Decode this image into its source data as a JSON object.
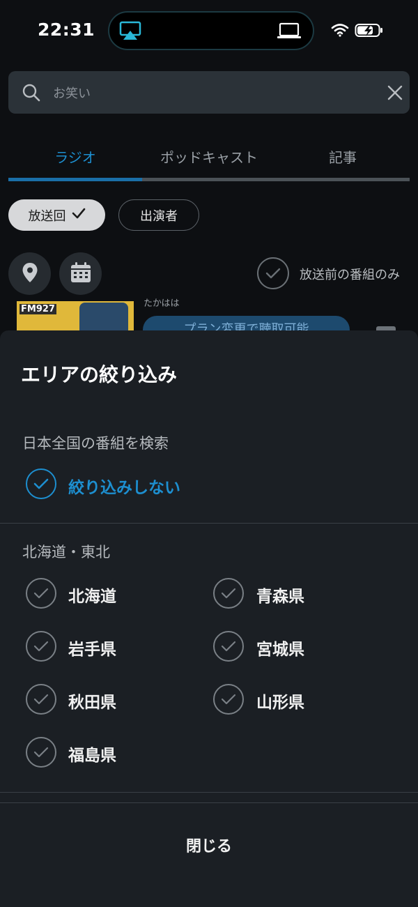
{
  "status_bar": {
    "time": "22:31"
  },
  "search": {
    "placeholder": "お笑い"
  },
  "tabs": [
    {
      "label": "ラジオ",
      "active": true
    },
    {
      "label": "ポッドキャスト",
      "active": false
    },
    {
      "label": "記事",
      "active": false
    }
  ],
  "filters": {
    "chips": [
      {
        "label": "放送回",
        "selected": true
      },
      {
        "label": "出演者",
        "selected": false
      }
    ],
    "pre_broadcast_only": {
      "label": "放送前の番組のみ",
      "checked": false
    }
  },
  "background_item": {
    "station_badge": "FM927",
    "performer": "たかはは",
    "action_label": "プラン変更で聴取可能"
  },
  "sheet": {
    "title": "エリアの絞り込み",
    "nationwide": {
      "label": "日本全国の番組を検索",
      "option": {
        "label": "絞り込みしない",
        "checked": true
      }
    },
    "region": {
      "label": "北海道・東北",
      "prefectures": [
        {
          "label": "北海道",
          "checked": false
        },
        {
          "label": "青森県",
          "checked": false
        },
        {
          "label": "岩手県",
          "checked": false
        },
        {
          "label": "宮城県",
          "checked": false
        },
        {
          "label": "秋田県",
          "checked": false
        },
        {
          "label": "山形県",
          "checked": false
        },
        {
          "label": "福島県",
          "checked": false
        }
      ]
    },
    "close_label": "閉じる"
  },
  "colors": {
    "accent": "#1d8fd0",
    "background": "#0d0f12",
    "sheet": "#1b1f24"
  }
}
